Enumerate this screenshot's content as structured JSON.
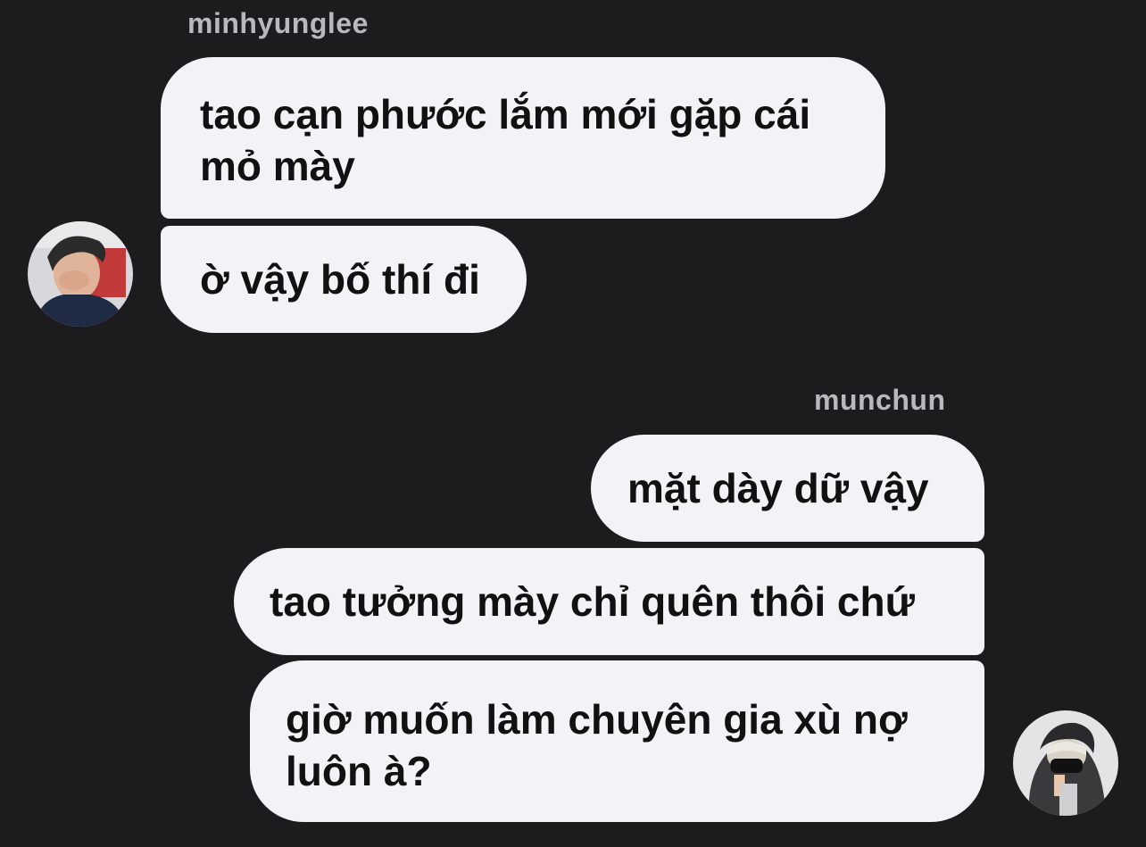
{
  "conversation": {
    "incoming": {
      "sender": "minhyunglee",
      "messages": [
        {
          "lines": [
            "tao cạn phước lắm mới gặp cái",
            "mỏ mày"
          ]
        },
        {
          "lines": [
            "ờ vậy bố thí đi"
          ]
        }
      ],
      "avatar_icon": "user-avatar-photo-icon"
    },
    "outgoing": {
      "sender": "munchun",
      "messages": [
        {
          "lines": [
            "mặt dày dữ vậy"
          ]
        },
        {
          "lines": [
            "tao tưởng mày chỉ quên thôi chứ"
          ]
        },
        {
          "lines": [
            "giờ muốn làm chuyên gia xù nợ",
            "luôn à?"
          ]
        }
      ],
      "avatar_icon": "user-avatar-photo-icon"
    }
  },
  "colors": {
    "background": "#1c1c1e",
    "bubble": "#f2f2f7",
    "bubble_text": "#111111",
    "sender_name": "#b9b9bd"
  }
}
